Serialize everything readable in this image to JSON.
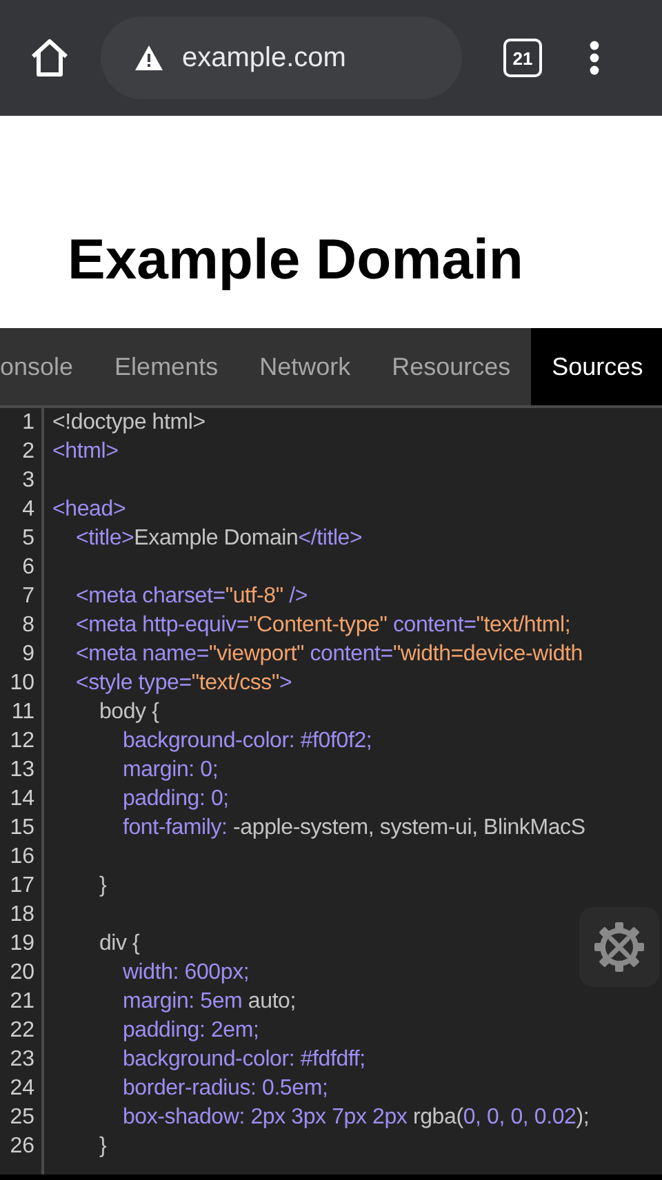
{
  "toolbar": {
    "url": "example.com",
    "tab_count": "21"
  },
  "page": {
    "heading": "Example Domain"
  },
  "devtools_tabs": [
    {
      "label": "onsole",
      "selected": false
    },
    {
      "label": "Elements",
      "selected": false
    },
    {
      "label": "Network",
      "selected": false
    },
    {
      "label": "Resources",
      "selected": false
    },
    {
      "label": "Sources",
      "selected": true
    }
  ],
  "code_lines": [
    {
      "number": "1",
      "tokens": [
        {
          "kind": "text",
          "text": "<!doctype html>"
        }
      ]
    },
    {
      "number": "2",
      "tokens": [
        {
          "kind": "tag",
          "text": "<html>"
        }
      ]
    },
    {
      "number": "3"
    },
    {
      "number": "4",
      "tokens": [
        {
          "kind": "tag",
          "text": "<head>"
        }
      ]
    },
    {
      "number": "5",
      "tokens": [
        {
          "kind": "tag",
          "text": "    <title>"
        },
        {
          "kind": "text",
          "text": "Example Domain"
        },
        {
          "kind": "tag",
          "text": "</title>"
        }
      ]
    },
    {
      "number": "6"
    },
    {
      "number": "7",
      "tokens": [
        {
          "kind": "tag",
          "text": "    <meta charset="
        },
        {
          "kind": "string",
          "text": "\"utf-8\""
        },
        {
          "kind": "tag",
          "text": " />"
        }
      ]
    },
    {
      "number": "8",
      "tokens": [
        {
          "kind": "tag",
          "text": "    <meta http-equiv="
        },
        {
          "kind": "string",
          "text": "\"Content-type\""
        },
        {
          "kind": "tag",
          "text": " content="
        },
        {
          "kind": "string",
          "text": "\"text/html;"
        }
      ]
    },
    {
      "number": "9",
      "tokens": [
        {
          "kind": "tag",
          "text": "    <meta name="
        },
        {
          "kind": "string",
          "text": "\"viewport\""
        },
        {
          "kind": "tag",
          "text": " content="
        },
        {
          "kind": "string",
          "text": "\"width=device-width"
        }
      ]
    },
    {
      "number": "10",
      "tokens": [
        {
          "kind": "tag",
          "text": "    <style type="
        },
        {
          "kind": "string",
          "text": "\"text/css\""
        },
        {
          "kind": "tag",
          "text": ">"
        }
      ]
    },
    {
      "number": "11",
      "tokens": [
        {
          "kind": "text",
          "text": "        body {"
        }
      ]
    },
    {
      "number": "12",
      "tokens": [
        {
          "kind": "tag",
          "text": "            background-color: #f0f0f2;"
        }
      ]
    },
    {
      "number": "13",
      "tokens": [
        {
          "kind": "tag",
          "text": "            margin: 0;"
        }
      ]
    },
    {
      "number": "14",
      "tokens": [
        {
          "kind": "tag",
          "text": "            padding: 0;"
        }
      ]
    },
    {
      "number": "15",
      "tokens": [
        {
          "kind": "tag",
          "text": "            font-family:"
        },
        {
          "kind": "text",
          "text": " -apple-system, system-ui, BlinkMacS"
        }
      ]
    },
    {
      "number": "16"
    },
    {
      "number": "17",
      "tokens": [
        {
          "kind": "text",
          "text": "        }"
        }
      ]
    },
    {
      "number": "18"
    },
    {
      "number": "19",
      "tokens": [
        {
          "kind": "text",
          "text": "        div {"
        }
      ]
    },
    {
      "number": "20",
      "tokens": [
        {
          "kind": "tag",
          "text": "            width: 600px;"
        }
      ]
    },
    {
      "number": "21",
      "tokens": [
        {
          "kind": "tag",
          "text": "            margin: 5em"
        },
        {
          "kind": "text",
          "text": " auto;"
        }
      ]
    },
    {
      "number": "22",
      "tokens": [
        {
          "kind": "tag",
          "text": "            padding: 2em;"
        }
      ]
    },
    {
      "number": "23",
      "tokens": [
        {
          "kind": "tag",
          "text": "            background-color: #fdfdff;"
        }
      ]
    },
    {
      "number": "24",
      "tokens": [
        {
          "kind": "tag",
          "text": "            border-radius: 0.5em;"
        }
      ]
    },
    {
      "number": "25",
      "tokens": [
        {
          "kind": "tag",
          "text": "            box-shadow: 2px 3px 7px 2px"
        },
        {
          "kind": "text",
          "text": " rgba("
        },
        {
          "kind": "tag",
          "text": "0, 0, 0, 0.02"
        },
        {
          "kind": "text",
          "text": ");"
        }
      ]
    },
    {
      "number": "26",
      "tokens": [
        {
          "kind": "text",
          "text": "        }"
        }
      ]
    }
  ]
}
